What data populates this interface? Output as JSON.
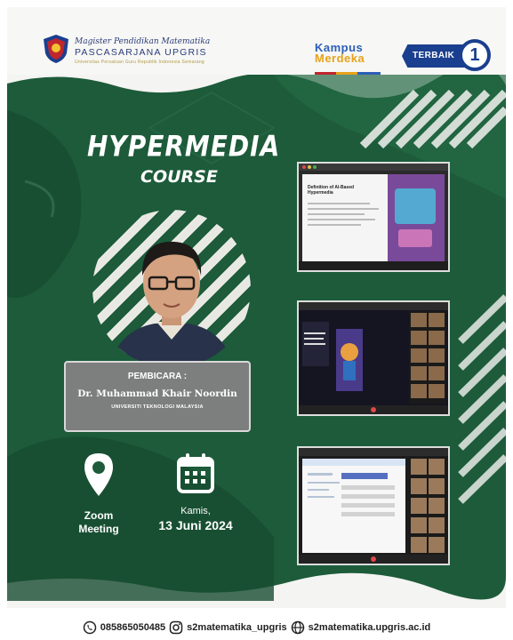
{
  "header": {
    "univ_line1": "Magister Pendidikan Matematika",
    "univ_line2": "PASCASARJANA UPGRIS",
    "univ_line3": "Universitas Persatuan Guru Republik Indonesia Semarang",
    "kampus_line1": "Kampus",
    "kampus_line2": "Merdeka",
    "terbaik": "TERBAIK",
    "terbaik_number": "1"
  },
  "title": {
    "line1": "HYPERMEDIA",
    "line2": "COURSE"
  },
  "speaker": {
    "label": "PEMBICARA :",
    "name": "Dr. Muhammad Khair Noordin",
    "university": "UNIVERSITI TEKNOLOGI MALAYSIA"
  },
  "venue": {
    "line1": "Zoom",
    "line2": "Meeting"
  },
  "event_date": {
    "day": "Kamis,",
    "date": "13 Juni 2024"
  },
  "screenshot_1": {
    "caption": "Definition of AI-Based Hypermedia"
  },
  "footer": {
    "phone": "085865050485",
    "instagram": "s2matematika_upgris",
    "website": "s2matematika.upgris.ac.id"
  },
  "colors": {
    "green": "#1d5b3a",
    "navy": "#1b3f8f",
    "accent_orange": "#e8a21b"
  }
}
